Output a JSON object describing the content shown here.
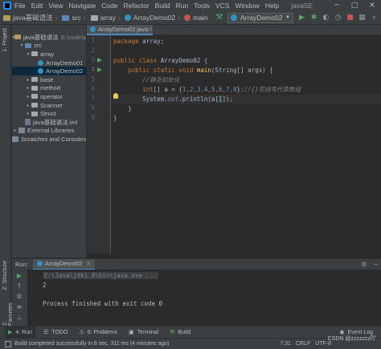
{
  "menubar": {
    "items": [
      "File",
      "Edit",
      "View",
      "Navigate",
      "Code",
      "Refactor",
      "Build",
      "Run",
      "Tools",
      "VCS",
      "Window",
      "Help"
    ],
    "project_title": "javaSE",
    "minimize": "─",
    "maximize": "□",
    "close": "✕"
  },
  "navbar": {
    "crumbs": [
      "java基础语法",
      "src",
      "array",
      "ArrayDemo02",
      "main"
    ],
    "run_config": "ArrayDemo02",
    "run_icon": "▶",
    "debug_icon": "✱",
    "search_icon": "⌕"
  },
  "left_stripe": {
    "project_label": "1: Project",
    "structure_label": "Z: Structure",
    "favorites_label": "2: Favorites"
  },
  "project_tree": {
    "root": {
      "name": "java基础语法",
      "path": "E:\\code\\ja"
    },
    "items": [
      {
        "label": "src",
        "indent": 1,
        "icon": "folder-blue",
        "arrow": "▾"
      },
      {
        "label": "array",
        "indent": 2,
        "icon": "package",
        "arrow": "▾"
      },
      {
        "label": "ArrayDemo01",
        "indent": 3,
        "icon": "class",
        "arrow": ""
      },
      {
        "label": "ArrayDemo02",
        "indent": 3,
        "icon": "class",
        "arrow": "",
        "selected": true
      },
      {
        "label": "base",
        "indent": 2,
        "icon": "package",
        "arrow": "▸"
      },
      {
        "label": "method",
        "indent": 2,
        "icon": "package",
        "arrow": "▸"
      },
      {
        "label": "operator",
        "indent": 2,
        "icon": "package",
        "arrow": "▸"
      },
      {
        "label": "Scanner",
        "indent": 2,
        "icon": "package",
        "arrow": "▸"
      },
      {
        "label": "Struct",
        "indent": 2,
        "icon": "package",
        "arrow": "▸"
      },
      {
        "label": "java基础语法.iml",
        "indent": 1,
        "icon": "iml",
        "arrow": ""
      },
      {
        "label": "External Libraries",
        "indent": 0,
        "icon": "library",
        "arrow": "▸"
      },
      {
        "label": "Scratches and Consoles",
        "indent": 0,
        "icon": "scratch",
        "arrow": ""
      }
    ]
  },
  "editor": {
    "tab_label": "ArrayDemo02.java",
    "tab_close": "✕",
    "line_numbers": [
      "1",
      "2",
      "3",
      "4",
      "5",
      "6",
      "7",
      "8",
      "9"
    ],
    "code": {
      "l1_kw": "package",
      "l1_rest": " array;",
      "l3_kw": "public class",
      "l3_rest": " ArrayDemo02 {",
      "l4_kw": "public static void",
      "l4_mt": "main",
      "l4_rest": "(String[] args) {",
      "l5_cm": "//静态初始化",
      "l6_kw": "int",
      "l6_a": "[] a = {",
      "l6_nums": [
        "1",
        "2",
        "3",
        "4",
        "5",
        "6",
        "7",
        "8"
      ],
      "l6_cm": "//{}花括号代表数组",
      "l7_a": "System.",
      "l7_out": "out",
      "l7_b": ".println(a[",
      "l7_idx": "1",
      "l7_c": "]);",
      "l8": "}",
      "l9": "}"
    }
  },
  "run_panel": {
    "label": "Run:",
    "tab": "ArrayDemo02",
    "tab_close": "✕",
    "command": "E:\\Java\\jdk1.8\\bin\\java.exe ...",
    "output": "2",
    "exit_message": "Process finished with exit code 0",
    "settings_icon": "⚙",
    "hide_icon": "─"
  },
  "bottom_tabs": {
    "run": "4: Run",
    "todo": "TODO",
    "problems": "6: Problems",
    "terminal": "Terminal",
    "build": "Build",
    "event_log": "Event Log"
  },
  "statusbar": {
    "message": "Build completed successfully in 8 sec, 311 ms (4 minutes ago)",
    "position": "7:31",
    "line_sep": "CRLF",
    "encoding": "UTF-8"
  },
  "watermark": "CSDN @zzzzzzz吖"
}
